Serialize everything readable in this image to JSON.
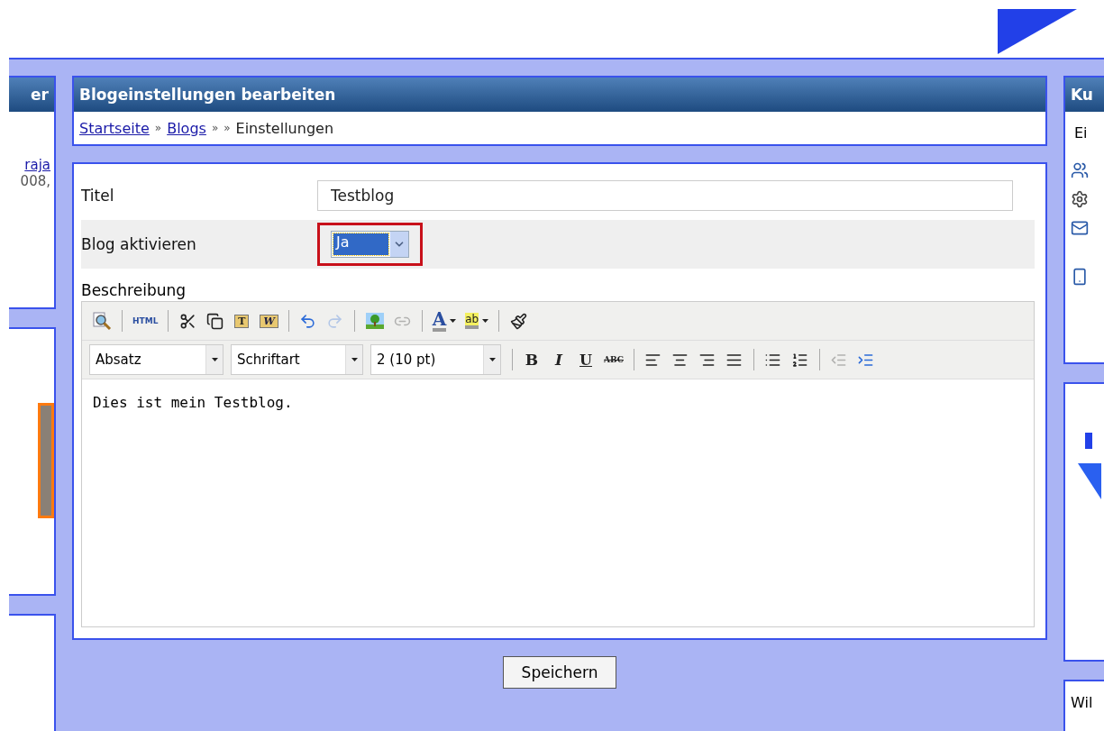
{
  "left_column": {
    "panels": [
      {
        "kind": "links",
        "title": "er",
        "link": "raja",
        "text": "008,"
      },
      {
        "kind": "photo"
      },
      {
        "kind": "empty"
      }
    ]
  },
  "header": {
    "title": "Blogeinstellungen bearbeiten",
    "breadcrumbs": [
      {
        "kind": "link",
        "label": "Startseite"
      },
      {
        "kind": "separator",
        "label": "»"
      },
      {
        "kind": "link",
        "label": "Blogs"
      },
      {
        "kind": "separator",
        "label": "»"
      },
      {
        "kind": "separator",
        "label": "»"
      },
      {
        "kind": "current",
        "label": "Einstellungen"
      }
    ]
  },
  "form": {
    "fields": [
      {
        "kind": "text",
        "label": "Titel",
        "value": "Testblog"
      },
      {
        "kind": "select",
        "label": "Blog aktivieren",
        "value": "Ja",
        "highlighted": true
      }
    ],
    "editor": {
      "label": "Beschreibung",
      "toolbar_1": [
        {
          "kind": "preview",
          "disabled": false
        },
        {
          "kind": "separator"
        },
        {
          "kind": "html",
          "label": "HTML",
          "disabled": false
        },
        {
          "kind": "separator"
        },
        {
          "kind": "cut",
          "disabled": false
        },
        {
          "kind": "copy",
          "disabled": false
        },
        {
          "kind": "paste-text",
          "label": "T",
          "disabled": false
        },
        {
          "kind": "paste-word",
          "label": "W",
          "disabled": false
        },
        {
          "kind": "separator"
        },
        {
          "kind": "undo",
          "disabled": false
        },
        {
          "kind": "redo",
          "disabled": true
        },
        {
          "kind": "separator"
        },
        {
          "kind": "image",
          "disabled": false
        },
        {
          "kind": "link",
          "disabled": true
        },
        {
          "kind": "separator"
        },
        {
          "kind": "font-color",
          "label": "A",
          "disabled": false
        },
        {
          "kind": "highlight-color",
          "label": "ab",
          "disabled": false
        },
        {
          "kind": "separator"
        },
        {
          "kind": "cleanup",
          "disabled": false
        }
      ],
      "selects": [
        {
          "value": "Absatz"
        },
        {
          "value": "Schriftart"
        },
        {
          "value": "2 (10 pt)"
        }
      ],
      "toolbar_2": [
        {
          "kind": "bold",
          "label": "B",
          "disabled": false
        },
        {
          "kind": "italic",
          "label": "I",
          "disabled": false
        },
        {
          "kind": "underline",
          "label": "U",
          "disabled": false
        },
        {
          "kind": "strike",
          "label": "ABC",
          "disabled": false
        },
        {
          "kind": "separator"
        },
        {
          "kind": "align-left",
          "disabled": false
        },
        {
          "kind": "align-center",
          "disabled": false
        },
        {
          "kind": "align-right",
          "disabled": false
        },
        {
          "kind": "align-justify",
          "disabled": false
        },
        {
          "kind": "separator"
        },
        {
          "kind": "bullet-list",
          "disabled": false
        },
        {
          "kind": "number-list",
          "disabled": false
        },
        {
          "kind": "separator"
        },
        {
          "kind": "outdent",
          "disabled": true
        },
        {
          "kind": "indent",
          "disabled": false
        }
      ],
      "content": "Dies ist mein Testblog."
    },
    "submit": "Speichern"
  },
  "right_column": {
    "panels": [
      {
        "kind": "icons",
        "title": "Ku",
        "text": "Ei"
      },
      {
        "kind": "logo"
      },
      {
        "kind": "text",
        "text": "Wil"
      }
    ]
  }
}
